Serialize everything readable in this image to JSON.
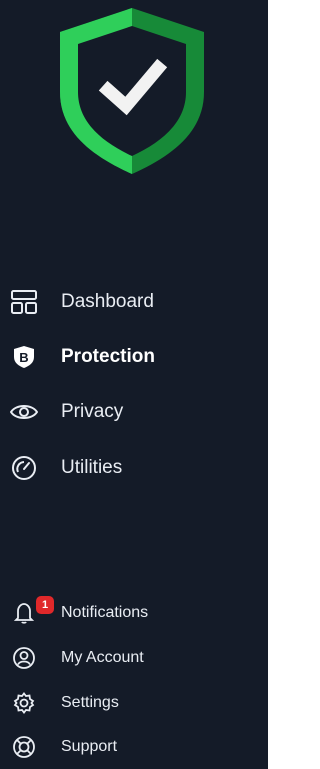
{
  "colors": {
    "background": "#141b28",
    "shield_dark": "#178a38",
    "shield_light": "#2fcf5a",
    "check": "#ffffff",
    "badge": "#e0282a"
  },
  "main_nav": [
    {
      "label": "Dashboard",
      "icon": "dashboard-icon",
      "active": false
    },
    {
      "label": "Protection",
      "icon": "protection-b-shield-icon",
      "active": true
    },
    {
      "label": "Privacy",
      "icon": "eye-icon",
      "active": false
    },
    {
      "label": "Utilities",
      "icon": "speedometer-icon",
      "active": false
    }
  ],
  "bottom_nav": [
    {
      "label": "Notifications",
      "icon": "bell-icon",
      "badge": "1"
    },
    {
      "label": "My Account",
      "icon": "user-icon"
    },
    {
      "label": "Settings",
      "icon": "gear-icon"
    },
    {
      "label": "Support",
      "icon": "lifebuoy-icon"
    }
  ]
}
